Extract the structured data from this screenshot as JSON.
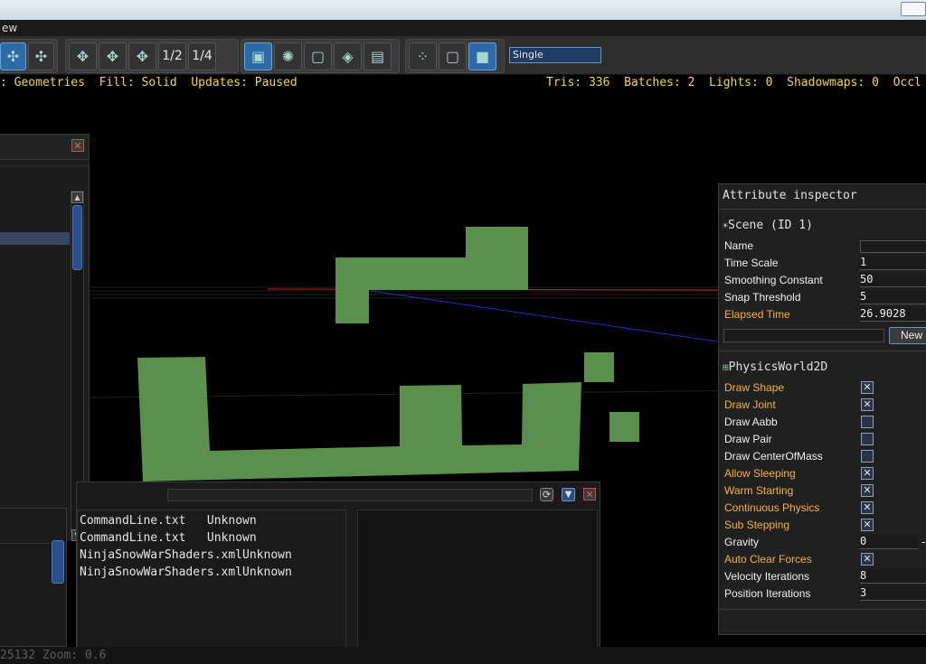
{
  "menu": {
    "item": "ew"
  },
  "toolbar": {
    "fraction_half": "1/2",
    "fraction_quarter": "1/4",
    "view_mode": "Single"
  },
  "stats_left": {
    "mode": ": Geometries",
    "fill": "Fill: Solid",
    "updates": "Updates: Paused"
  },
  "stats_right": {
    "tris": "Tris: 336",
    "batches": "Batches: 2",
    "lights": "Lights: 0",
    "shadowmaps": "Shadowmaps: 0",
    "occl": "Occl"
  },
  "inspector": {
    "title": "Attribute inspector",
    "scene_header": "Scene (ID 1)",
    "scene_attrs": [
      {
        "label": "Name",
        "value": ""
      },
      {
        "label": "Time Scale",
        "value": "1"
      },
      {
        "label": "Smoothing Constant",
        "value": "50"
      },
      {
        "label": "Snap Threshold",
        "value": "5"
      },
      {
        "label": "Elapsed Time",
        "value": "26.9028"
      }
    ],
    "new_button": "New",
    "physics_header": "PhysicsWorld2D",
    "physics_attrs": [
      {
        "label": "Draw Shape",
        "checked": true
      },
      {
        "label": "Draw Joint",
        "checked": true
      },
      {
        "label": "Draw Aabb",
        "checked": false
      },
      {
        "label": "Draw Pair",
        "checked": false
      },
      {
        "label": "Draw CenterOfMass",
        "checked": false
      },
      {
        "label": "Allow Sleeping",
        "checked": true
      },
      {
        "label": "Warm Starting",
        "checked": true
      },
      {
        "label": "Continuous Physics",
        "checked": true
      },
      {
        "label": "Sub Stepping",
        "checked": true
      },
      {
        "label": "Gravity",
        "value": "0"
      },
      {
        "label": "Auto Clear Forces",
        "checked": true
      },
      {
        "label": "Velocity Iterations",
        "value": "8"
      },
      {
        "label": "Position Iterations",
        "value": "3"
      }
    ],
    "gravity_dash": "-"
  },
  "resource_log": [
    {
      "name": "CommandLine.txt",
      "type": "Unknown"
    },
    {
      "name": "CommandLine.txt",
      "type": "Unknown"
    },
    {
      "name": "NinjaSnowWarShaders.xml",
      "type": "Unknown"
    },
    {
      "name": "NinjaSnowWarShaders.xml",
      "type": "Unknown"
    }
  ],
  "status_bar": {
    "text": "25132 Zoom: 0.6"
  },
  "colors": {
    "geometry": "#5a8f4e",
    "accent": "#f0d850",
    "modified": "#f5b342"
  }
}
